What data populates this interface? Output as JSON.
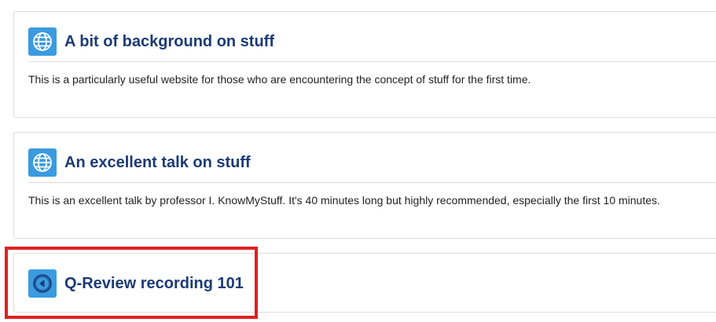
{
  "resources": [
    {
      "title": "A bit of background on stuff",
      "description": "This is a particularly useful website for those who are encountering the concept of stuff for the first time.",
      "icon": "globe-icon"
    },
    {
      "title": "An excellent talk on stuff",
      "description": "This is an excellent talk by professor I. KnowMyStuff. It's 40 minutes long but highly recommended, especially the first 10 minutes.",
      "icon": "globe-icon"
    },
    {
      "title": "Q-Review recording 101",
      "icon": "play-back-icon"
    }
  ],
  "colors": {
    "accent": "#3a9be0",
    "title": "#1b3b76",
    "highlight": "#e02020",
    "border": "#dcdcdc"
  }
}
